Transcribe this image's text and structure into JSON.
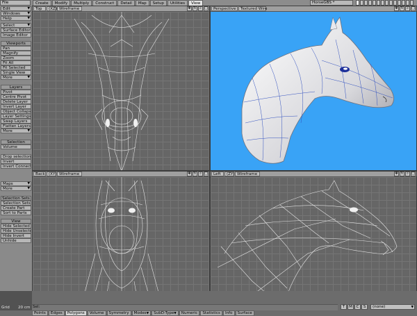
{
  "menu": {
    "file": "File"
  },
  "tabs": [
    {
      "label": "Create",
      "active": false
    },
    {
      "label": "Modify",
      "active": false
    },
    {
      "label": "Multiply",
      "active": false
    },
    {
      "label": "Construct",
      "active": false
    },
    {
      "label": "Detail",
      "active": false
    },
    {
      "label": "Map",
      "active": false
    },
    {
      "label": "Setup",
      "active": false
    },
    {
      "label": "Utilities",
      "active": false
    },
    {
      "label": "View",
      "active": true
    }
  ],
  "scene": "HorseGBS *",
  "toolbar": {
    "edit": "Edit",
    "windows": "Windows",
    "help": "Help",
    "select": "Select",
    "surface_editor": "Surface Editor",
    "image_editor": "Image Editor",
    "viewports_head": "Viewports",
    "pan": "Pan",
    "magnify": "Magnify",
    "zoom": "Zoom",
    "fit_all": "Fit All",
    "fit_selected": "Fit Selected",
    "single_view": "Single View",
    "more1": "More",
    "layers_head": "Layers",
    "pivot": "Pivot",
    "centre_pivot": "Centre Pivot",
    "delete_layer": "Delete Layer",
    "invert_layer": "Invert Layer",
    "object_collapse": "Object Collapse",
    "layer_settings": "Layer Settings",
    "swap_layers": "Swap Layers",
    "flatten_layers": "Flatten Layers",
    "more2": "More",
    "selection_head": "Selection",
    "volume": "Volume",
    "drop_selection": "Drop selection",
    "invert": "Invert",
    "invert_connected": "Invert Connected",
    "maps": "Maps",
    "more3": "More",
    "selection_sets_head": "Selection Sets",
    "selection_sets": "Selection Sets",
    "create_part": "Create Part",
    "sort_to_parts": "Sort to Parts",
    "view_head": "View",
    "hide_selected": "Hide Selected",
    "hide_unselected": "Hide Unselected",
    "hide_invert": "Hide Invert",
    "unhide": "Unhide"
  },
  "viewports": {
    "tl": {
      "view": "Top",
      "axis": "(XZ)",
      "mode": "Wireframe"
    },
    "tr": {
      "view": "Perspective",
      "mode": "Textured Wire"
    },
    "bl": {
      "view": "Back",
      "axis": "(XY)",
      "mode": "Wireframe"
    },
    "br": {
      "view": "Left",
      "axis": "(ZY)",
      "mode": "Wireframe"
    }
  },
  "bottom": {
    "grid_label": "Grid",
    "grid_value": "20 cm",
    "sel_label": "Sel:",
    "tmcs": [
      "T",
      "M",
      "C",
      "S"
    ],
    "none": "(none)",
    "tabs": [
      {
        "label": "Points",
        "active": false,
        "dd": false
      },
      {
        "label": "Edges",
        "active": false,
        "dd": false
      },
      {
        "label": "Polygons",
        "active": true,
        "dd": false
      },
      {
        "label": "Volume",
        "active": false,
        "dd": false
      },
      {
        "label": "Symmetry",
        "active": false,
        "dd": false
      },
      {
        "label": "Modes",
        "active": false,
        "dd": true
      },
      {
        "label": "SubD-Type",
        "active": false,
        "dd": true
      },
      {
        "label": "Numeric",
        "active": false,
        "dd": false
      },
      {
        "label": "Statistics",
        "active": false,
        "dd": false
      },
      {
        "label": "Info",
        "active": false,
        "dd": false
      },
      {
        "label": "Surface",
        "active": false,
        "dd": false
      }
    ]
  },
  "colors": {
    "persp_bg": "#39a3f6",
    "grid_bg": "#666666"
  }
}
